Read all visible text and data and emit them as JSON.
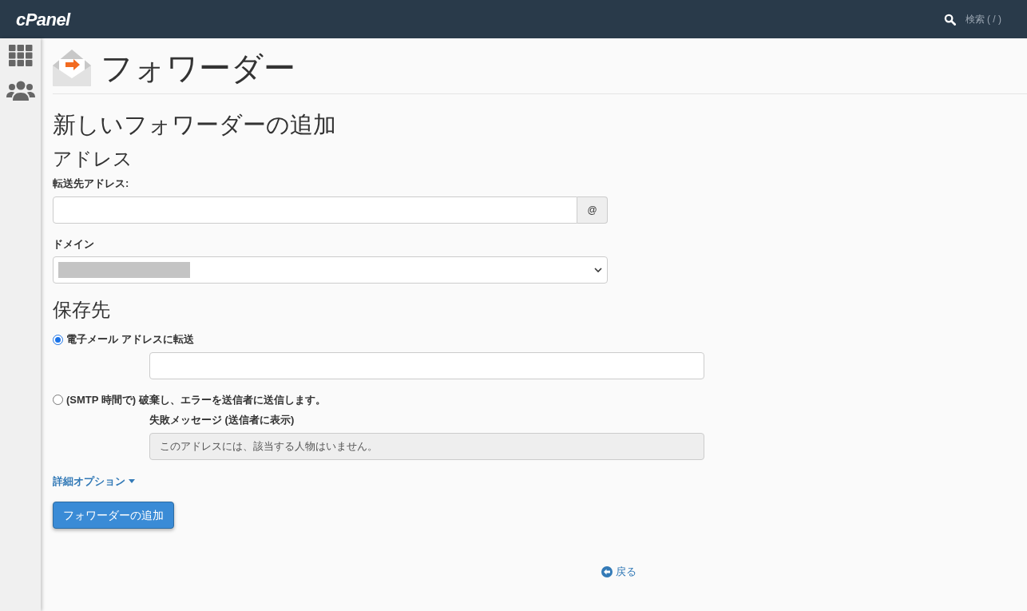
{
  "header": {
    "logo": "cPanel",
    "search_label": "検索 ( / )"
  },
  "page_title": "フォワーダー",
  "section_title": "新しいフォワーダーの追加",
  "address": {
    "heading": "アドレス",
    "forward_label": "転送先アドレス:",
    "at_addon": "@",
    "domain_label": "ドメイン"
  },
  "destination": {
    "heading": "保存先",
    "options": [
      {
        "kind": "forward",
        "label": "電子メール アドレスに転送",
        "selected": true
      },
      {
        "kind": "fail",
        "label": "(SMTP 時間で) 破棄し、エラーを送信者に送信します。",
        "selected": false,
        "message_label": "失敗メッセージ (送信者に表示)",
        "message_value": "このアドレスには、該当する人物はいません。"
      }
    ]
  },
  "advanced_link": "詳細オプション",
  "submit_button": "フォワーダーの追加",
  "back_link": "戻る"
}
